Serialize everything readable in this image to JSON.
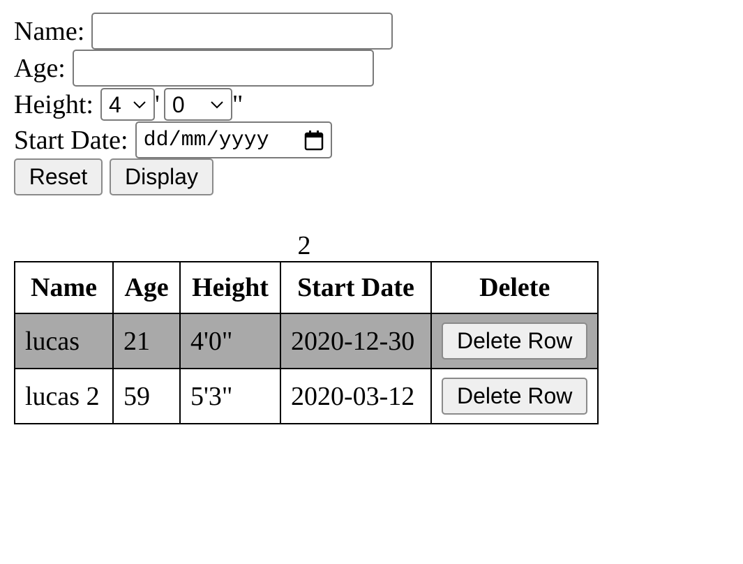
{
  "form": {
    "name_label": "Name:",
    "name_value": "",
    "age_label": "Age:",
    "age_value": "",
    "height_label": "Height:",
    "height_feet": "4",
    "feet_mark": "'",
    "height_inches": "0",
    "inches_mark": "\"",
    "start_date_label": "Start Date:",
    "start_date_placeholder": "dd/mm/yyyy",
    "reset_label": "Reset",
    "display_label": "Display"
  },
  "table": {
    "count": "2",
    "headers": [
      "Name",
      "Age",
      "Height",
      "Start Date",
      "Delete"
    ],
    "rows": [
      {
        "name": "lucas",
        "age": "21",
        "height": "4'0\"",
        "start_date": "2020-12-30",
        "delete_label": "Delete Row"
      },
      {
        "name": "lucas 2",
        "age": "59",
        "height": "5'3\"",
        "start_date": "2020-03-12",
        "delete_label": "Delete Row"
      }
    ]
  },
  "icons": {
    "select_arrow": "chevron-down-icon",
    "date_picker": "calendar-icon"
  },
  "colors": {
    "highlight_row": "#a9a9a9",
    "button_bg": "#efefef"
  }
}
